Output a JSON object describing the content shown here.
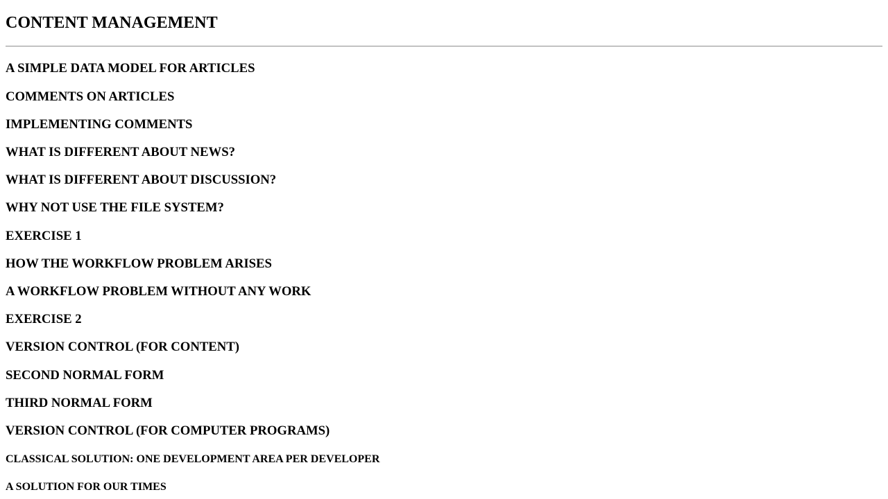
{
  "page": {
    "title": "CONTENT MANAGEMENT"
  },
  "sections": [
    "A SIMPLE DATA MODEL FOR ARTICLES",
    "COMMENTS ON ARTICLES",
    "IMPLEMENTING COMMENTS",
    "WHAT IS DIFFERENT ABOUT NEWS?",
    "WHAT IS DIFFERENT ABOUT DISCUSSION?",
    "WHY NOT USE THE FILE SYSTEM?",
    "EXERCISE 1",
    "HOW THE WORKFLOW PROBLEM ARISES",
    "A WORKFLOW PROBLEM WITHOUT ANY WORK",
    "EXERCISE 2",
    "VERSION CONTROL (FOR CONTENT)",
    "SECOND NORMAL FORM",
    "THIRD NORMAL FORM",
    "VERSION CONTROL (FOR COMPUTER PROGRAMS)"
  ],
  "subsections": [
    "CLASSICAL SOLUTION: ONE DEVELOPMENT AREA PER DEVELOPER",
    "A SOLUTION FOR OUR TIMES"
  ]
}
